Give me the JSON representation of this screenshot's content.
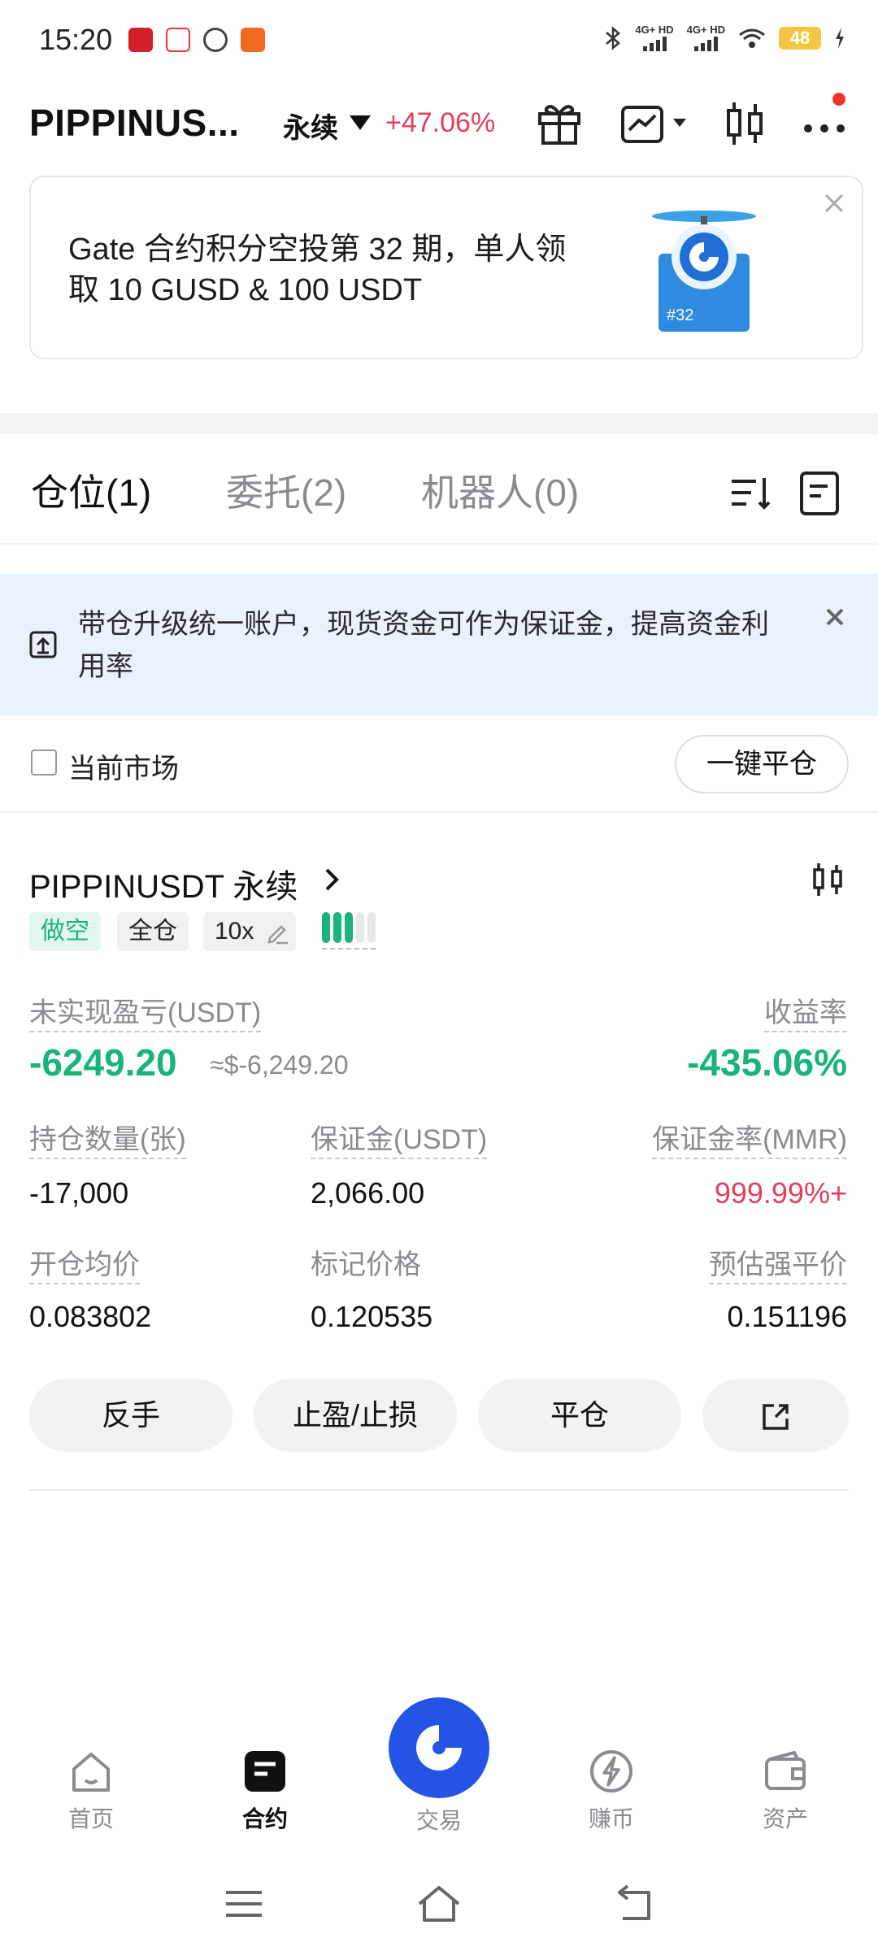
{
  "status_bar": {
    "time": "15:20",
    "net1": "4G+ HD",
    "net2": "4G+ HD",
    "battery": "48"
  },
  "header": {
    "pair": "PIPPINUS...",
    "contract_type": "永续",
    "change": "+47.06%"
  },
  "banner": {
    "text": "Gate 合约积分空投第 32 期，单人领取 10 GUSD & 100 USDT",
    "badge": "#32"
  },
  "tabs": [
    {
      "label": "仓位(1)"
    },
    {
      "label": "委托(2)"
    },
    {
      "label": "机器人(0)"
    }
  ],
  "notice": {
    "text": "带仓升级统一账户，现货资金可作为保证金，提高资金利用率"
  },
  "filter": {
    "current_market": "当前市场",
    "close_all": "一键平仓"
  },
  "position": {
    "title": "PIPPINUSDT 永续",
    "tags": {
      "side": "做空",
      "margin_mode": "全仓",
      "leverage": "10x"
    },
    "risk_level": 3,
    "risk_total": 5,
    "unrealized_pnl_label": "未实现盈亏(USDT)",
    "unrealized_pnl": "-6249.20",
    "unrealized_pnl_usd": "≈$-6,249.20",
    "roi_label": "收益率",
    "roi": "-435.06%",
    "qty_label": "持仓数量(张)",
    "qty": "-17,000",
    "margin_label": "保证金(USDT)",
    "margin": "2,066.00",
    "mmr_label": "保证金率(MMR)",
    "mmr": "999.99%+",
    "entry_label": "开仓均价",
    "entry": "0.083802",
    "mark_label": "标记价格",
    "mark": "0.120535",
    "liq_label": "预估强平价",
    "liq": "0.151196",
    "actions": {
      "reverse": "反手",
      "tpsl": "止盈/止损",
      "close": "平仓"
    }
  },
  "bottom_nav": {
    "home": "首页",
    "futures": "合约",
    "trade": "交易",
    "earn": "赚币",
    "assets": "资产"
  },
  "colors": {
    "green": "#19b47a",
    "red": "#e0405e",
    "brand_blue": "#2354e6",
    "notice_bg": "#eaf3fd"
  }
}
